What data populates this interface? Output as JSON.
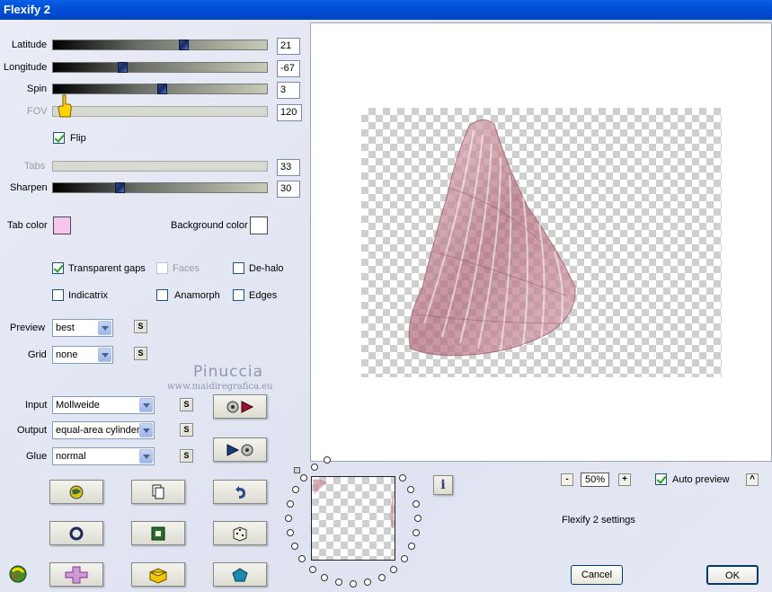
{
  "window": {
    "title": "Flexify 2"
  },
  "sliders": [
    {
      "label": "Latitude",
      "value": "21",
      "level": 0.62,
      "enabled": true
    },
    {
      "label": "Longitude",
      "value": "-67",
      "level": 0.33,
      "enabled": true
    },
    {
      "label": "Spin",
      "value": "3",
      "level": 0.51,
      "enabled": true
    },
    {
      "label": "FOV",
      "value": "120",
      "level": 0.0,
      "enabled": false
    }
  ],
  "flip": {
    "label": "Flip",
    "checked": true
  },
  "tabs": {
    "label": "Tabs",
    "value": "33",
    "enabled": false
  },
  "sharpen": {
    "label": "Sharpen",
    "value": "30",
    "level": 0.31
  },
  "colors": {
    "tab_color_label": "Tab color",
    "tab_color": "#f6c6ee",
    "background_color_label": "Background color",
    "background_color": "#ffffff"
  },
  "options": {
    "transparent_gaps": {
      "label": "Transparent gaps",
      "checked": true
    },
    "faces": {
      "label": "Faces",
      "checked": false,
      "enabled": false
    },
    "de_halo": {
      "label": "De-halo",
      "checked": false
    },
    "indicatrix": {
      "label": "Indicatrix",
      "checked": false
    },
    "anamorph": {
      "label": "Anamorph",
      "checked": false
    },
    "edges": {
      "label": "Edges",
      "checked": false
    }
  },
  "preview_select": {
    "label": "Preview",
    "value": "best"
  },
  "grid_select": {
    "label": "Grid",
    "value": "none"
  },
  "input_select": {
    "label": "Input",
    "value": "Mollweide"
  },
  "output_select": {
    "label": "Output",
    "value": "equal-area cylinder"
  },
  "glue_select": {
    "label": "Glue",
    "value": "normal"
  },
  "small_button_label": "S",
  "watermark": {
    "name": "Pinuccia",
    "site": "www.maidiregrafica.eu"
  },
  "zoom": {
    "minus": "-",
    "value": "50%",
    "plus": "+"
  },
  "auto_preview": {
    "label": "Auto preview",
    "checked": true,
    "collapse": "^"
  },
  "settings_name": "Flexify 2 settings",
  "info_label": "i",
  "buttons": {
    "cancel": "Cancel",
    "ok": "OK"
  },
  "accent_colors": {
    "titlebar": "#0050d8",
    "shape": "#b0707c"
  }
}
